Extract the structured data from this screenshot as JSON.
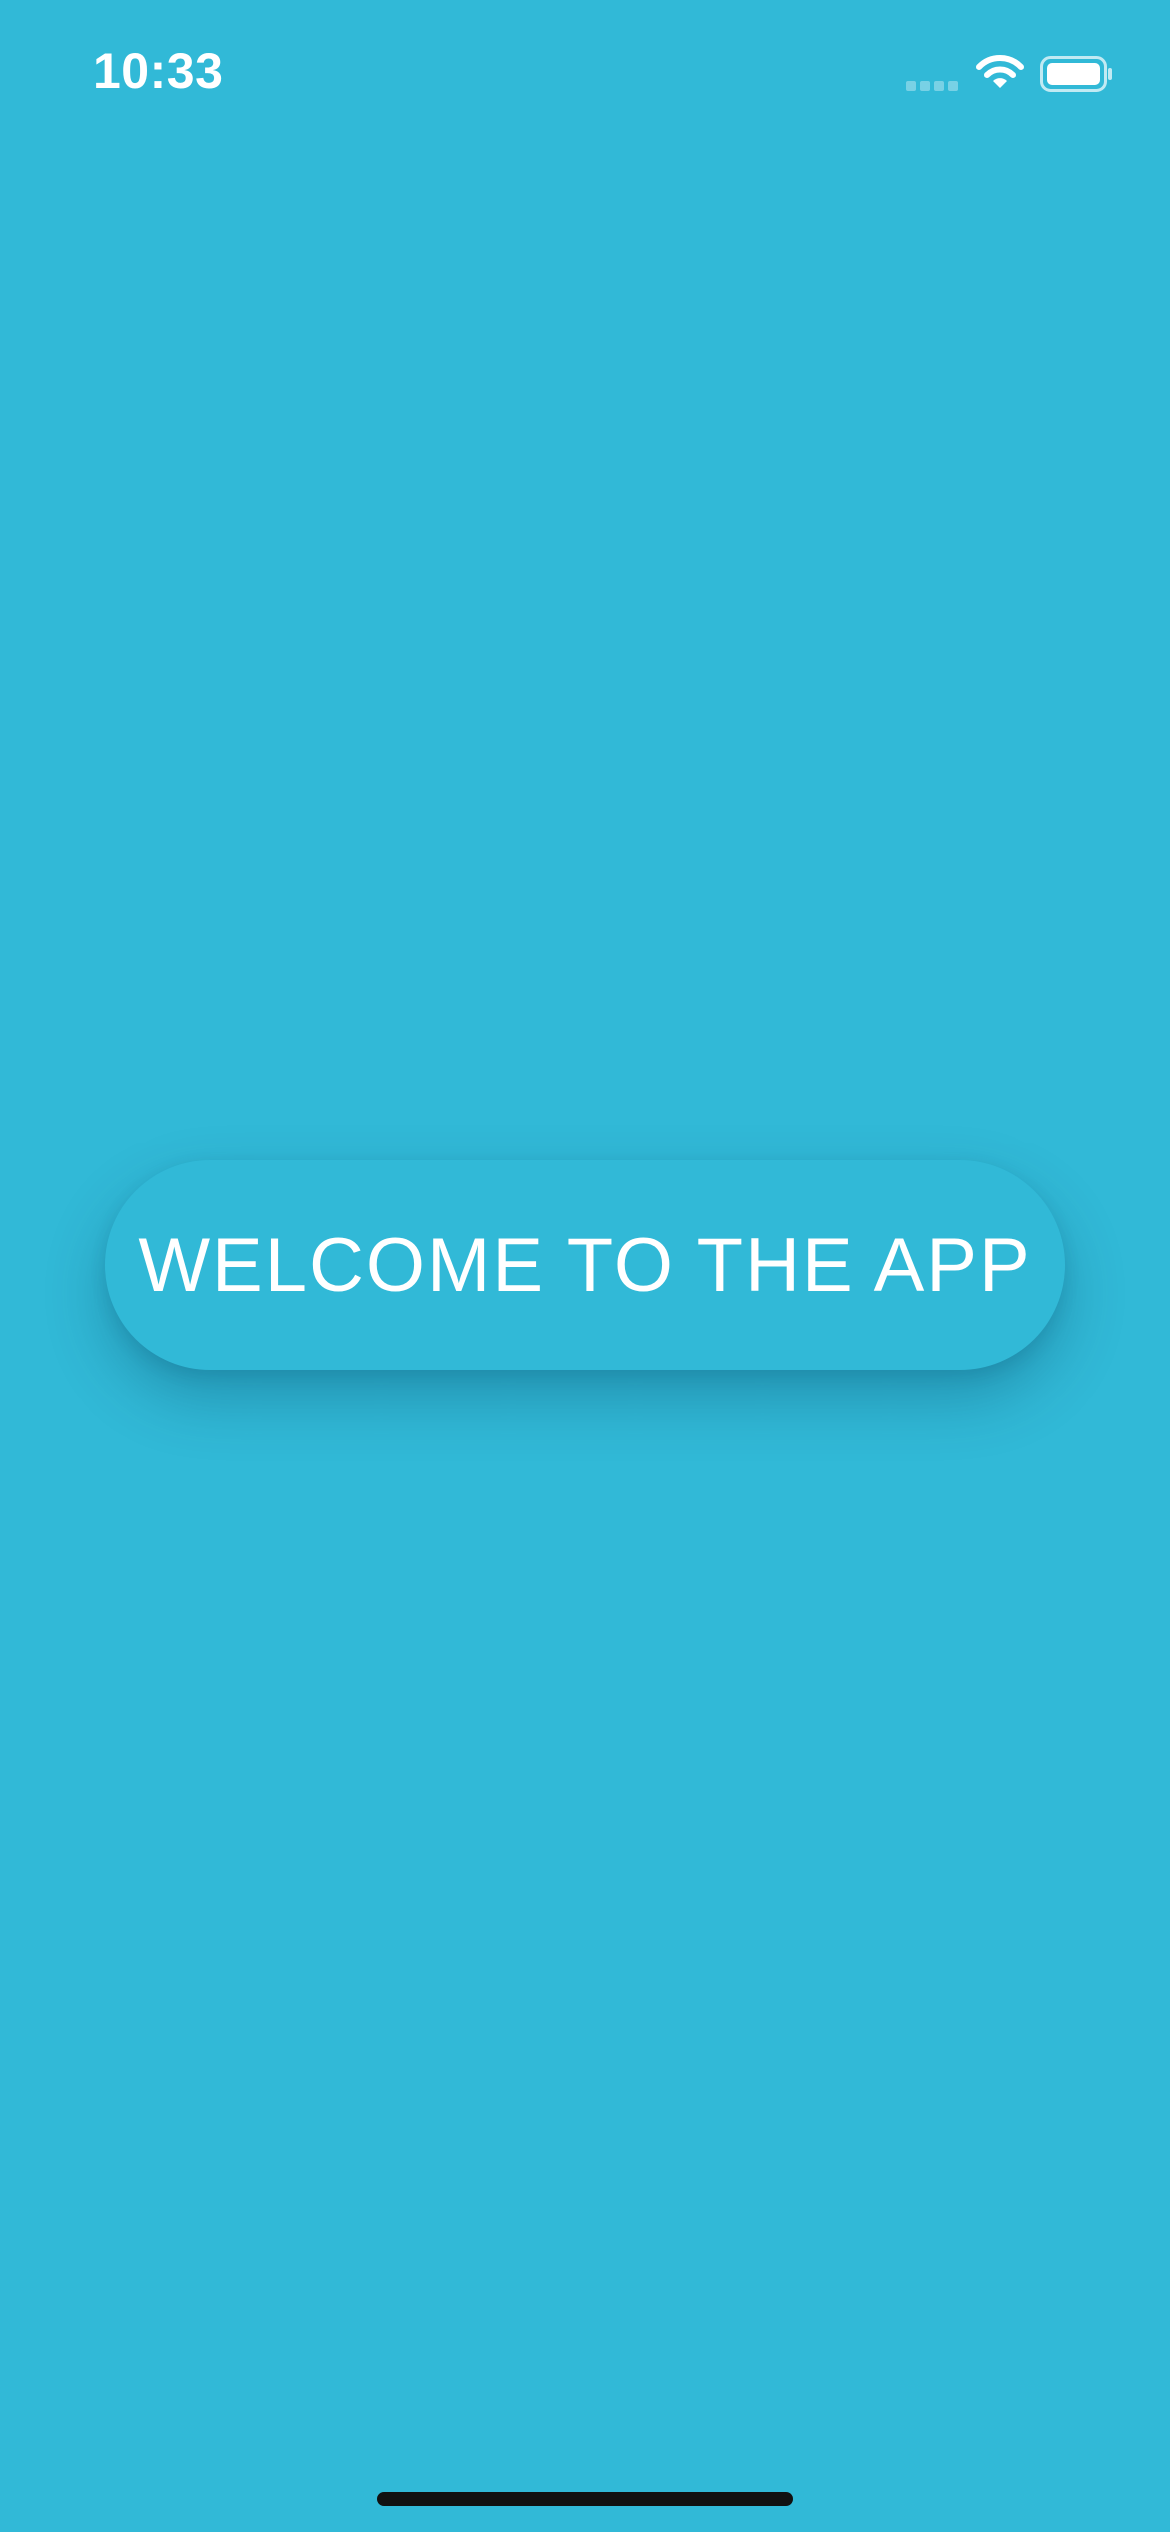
{
  "status_bar": {
    "time": "10:33",
    "icons": [
      "cellular-signal-icon",
      "wifi-icon",
      "battery-icon"
    ]
  },
  "main": {
    "welcome_button_label": "WELCOME TO THE APP"
  },
  "colors": {
    "background": "#31B9D7",
    "text": "#FFFFFF",
    "home_indicator": "#111111"
  }
}
